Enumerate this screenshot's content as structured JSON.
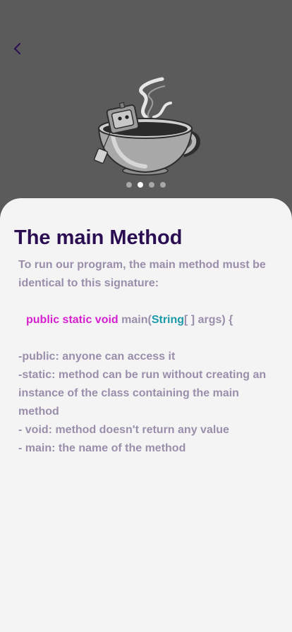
{
  "header": {
    "back_icon": "chevron-left-icon"
  },
  "illustration": {
    "name": "java-coffee-cup-illustration"
  },
  "pager": {
    "count": 4,
    "active_index": 1
  },
  "slide": {
    "title": "The main Method",
    "intro": "To run our program, the main method must be identical to this signature:",
    "code": {
      "modifiers": "public static void",
      "method": "main(",
      "type": "String",
      "brackets": "[ ]",
      "rest": "args) {"
    },
    "notes": [
      "-public: anyone can access it",
      "-static: method can be run without creating an instance of the class containing the main method",
      "- void: method doesn't return any value",
      "- main: the name of the method"
    ]
  },
  "colors": {
    "top_background": "#5b5b5b",
    "sheet_background": "#f4f4f4",
    "title": "#2b0e52",
    "body_text": "#9a8fab",
    "keyword": "#d61fd0",
    "type": "#1c9aa8"
  }
}
